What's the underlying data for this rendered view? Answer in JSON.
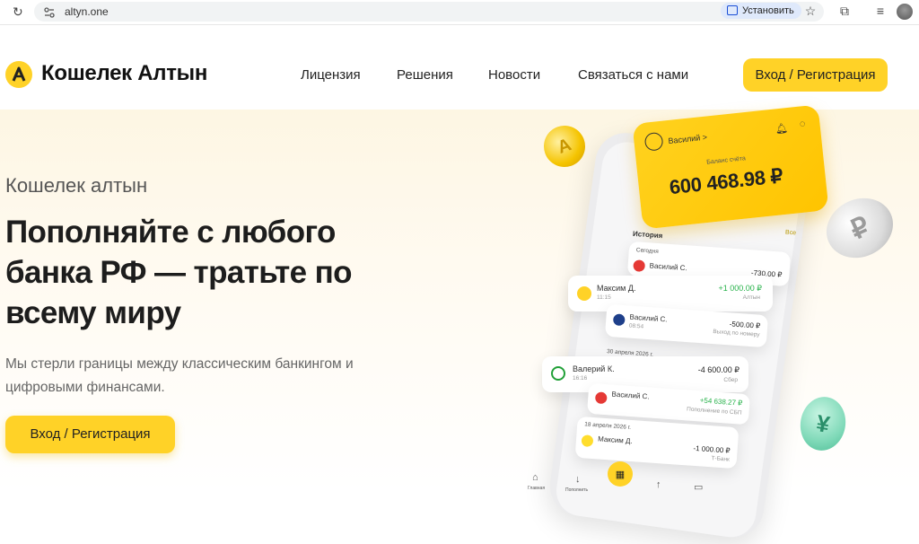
{
  "browser": {
    "url": "altyn.one",
    "install_label": "Установить"
  },
  "header": {
    "brand": "Кошелек Алтын",
    "nav": [
      "Лицензия",
      "Решения",
      "Новости",
      "Связаться с нами"
    ],
    "cta": "Вход / Регистрация"
  },
  "hero": {
    "subtitle": "Кошелек алтын",
    "headline": "Пополняйте с любого банка РФ — тратьте по всему миру",
    "lead": "Мы стерли границы между классическим банкингом и цифровыми финансами.",
    "cta": "Вход / Регистрация"
  },
  "app": {
    "user": "Василий >",
    "balance_label": "Баланс счёта",
    "balance": "600 468.98 ₽",
    "history_title": "История",
    "history_all": "Все",
    "today_label": "Сегодня",
    "date1": "30 апреля 2026 г.",
    "date2": "18 апреля 2026 г.",
    "transactions": [
      {
        "name": "Василий С.",
        "amount": "-730.00 ₽",
        "sub": ""
      },
      {
        "name": "Максим Д.",
        "sub": "11:15",
        "amount": "+1 000.00 ₽",
        "note": "Алтын"
      },
      {
        "name": "Василий С.",
        "sub": "08:54",
        "amount": "-500.00 ₽",
        "note": "Выход по номеру"
      },
      {
        "name": "Валерий К.",
        "sub": "16:16",
        "amount": "-4 600.00 ₽",
        "note": "Сбер"
      },
      {
        "name": "Василий С.",
        "sub": "",
        "amount": "+54 638.27 ₽",
        "note": "Пополнение по СБП"
      },
      {
        "name": "Максим Д.",
        "sub": "",
        "amount": "-1 000.00 ₽",
        "note": "Т-Банк"
      }
    ],
    "bottom_nav": [
      "Главная",
      "Пополнить"
    ]
  },
  "colors": {
    "accent": "#ffd227",
    "positive": "#27b24a"
  }
}
